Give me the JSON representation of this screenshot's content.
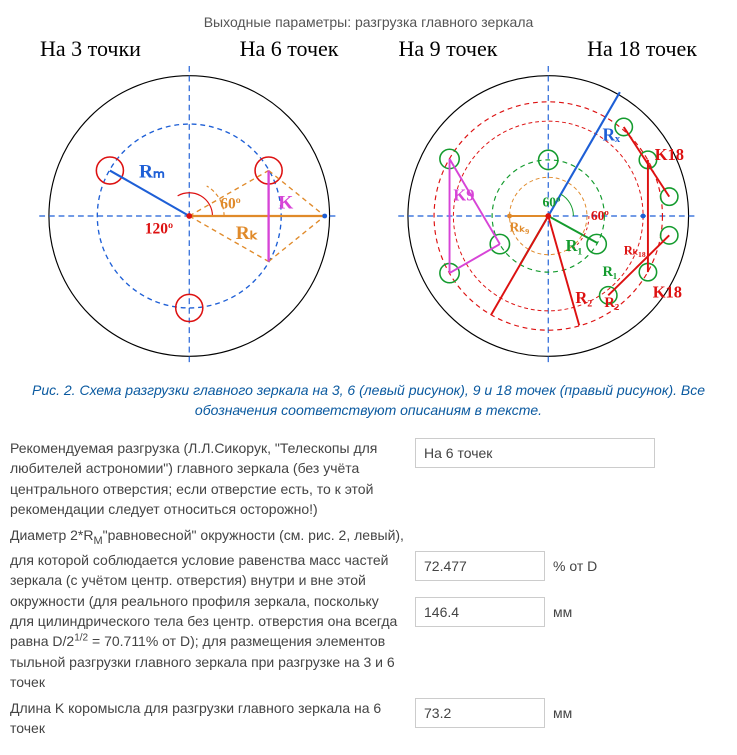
{
  "page_title": "Выходные параметры: разгрузка главного зеркала",
  "headers": {
    "h3": "На 3 точки",
    "h6": "На 6 точек",
    "h9": "На 9 точек",
    "h18": "На 18 точек"
  },
  "diagram_left": {
    "angle120": "120º",
    "angle60": "60º",
    "Rm": "Rₘ",
    "Rk": "Rₖ",
    "K": "K"
  },
  "diagram_right": {
    "angle60a": "60º",
    "angle60b": "60º",
    "Rx": "Rₓ",
    "R1a": "R₁",
    "R2a": "R₂",
    "R1b": "R₁",
    "R2b": "R₂",
    "K9": "K9",
    "Rk9": "Rₖ₉",
    "K18a": "K18",
    "K18b": "K18",
    "Rk18": "Rₖ₁₈"
  },
  "caption": "Рис. 2. Схема разгрузки главного зеркала на 3, 6 (левый рисунок), 9 и 18 точек (правый рисунок). Все обозначения соответствуют описаниям в тексте.",
  "rows": {
    "recommended": {
      "label": "Рекомендуемая разгрузка (Л.Л.Сикорук, \"Телескопы для любителей астрономии\") главного зеркала (без учёта центрального отверстия; если отверстие есть, то к этой рекомендации следует относиться осторожно!)",
      "value": "На 6 точек"
    },
    "diameter": {
      "label_pre": "Диаметр 2*R",
      "label_sub": "M",
      "label_mid": "\"равновесной\" окружности (см. рис. 2, левый), для которой соблюдается условие равенства масс частей зеркала (с учётом центр. отверстия) внутри и вне этой окружности (для реального профиля зеркала, поскольку для цилиндрического тела без центр. отверстия она всегда равна D/2",
      "label_sup": "1/2",
      "label_post": " = 70.711% от D); для размещения элементов тыльной разгрузки главного зеркала при разгрузке на 3 и 6 точек",
      "value_pct": "72.477",
      "unit_pct": "% от D",
      "value_mm": "146.4",
      "unit_mm": "мм"
    },
    "klen": {
      "label": "Длина K коромысла для разгрузки главного зеркала на 6 точек",
      "value": "73.2",
      "unit": "мм"
    }
  }
}
